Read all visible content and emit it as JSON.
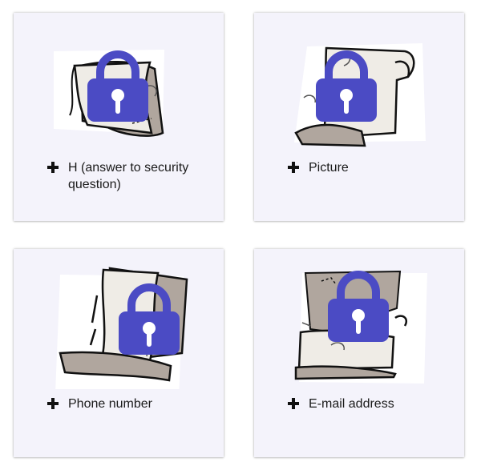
{
  "cards": [
    {
      "label": "H (answer to security question)",
      "icon": "lock-icon",
      "image": "treasure-map"
    },
    {
      "label": "Picture",
      "icon": "lock-icon",
      "image": "treasure-map"
    },
    {
      "label": "Phone number",
      "icon": "lock-icon",
      "image": "treasure-map"
    },
    {
      "label": "E-mail address",
      "icon": "lock-icon",
      "image": "treasure-map"
    }
  ],
  "colors": {
    "card_background": "#f4f3fb",
    "lock": "#4b4bc4",
    "map_paper": "#efece6",
    "map_shadow": "#b0a69e",
    "map_outline": "#111111"
  }
}
